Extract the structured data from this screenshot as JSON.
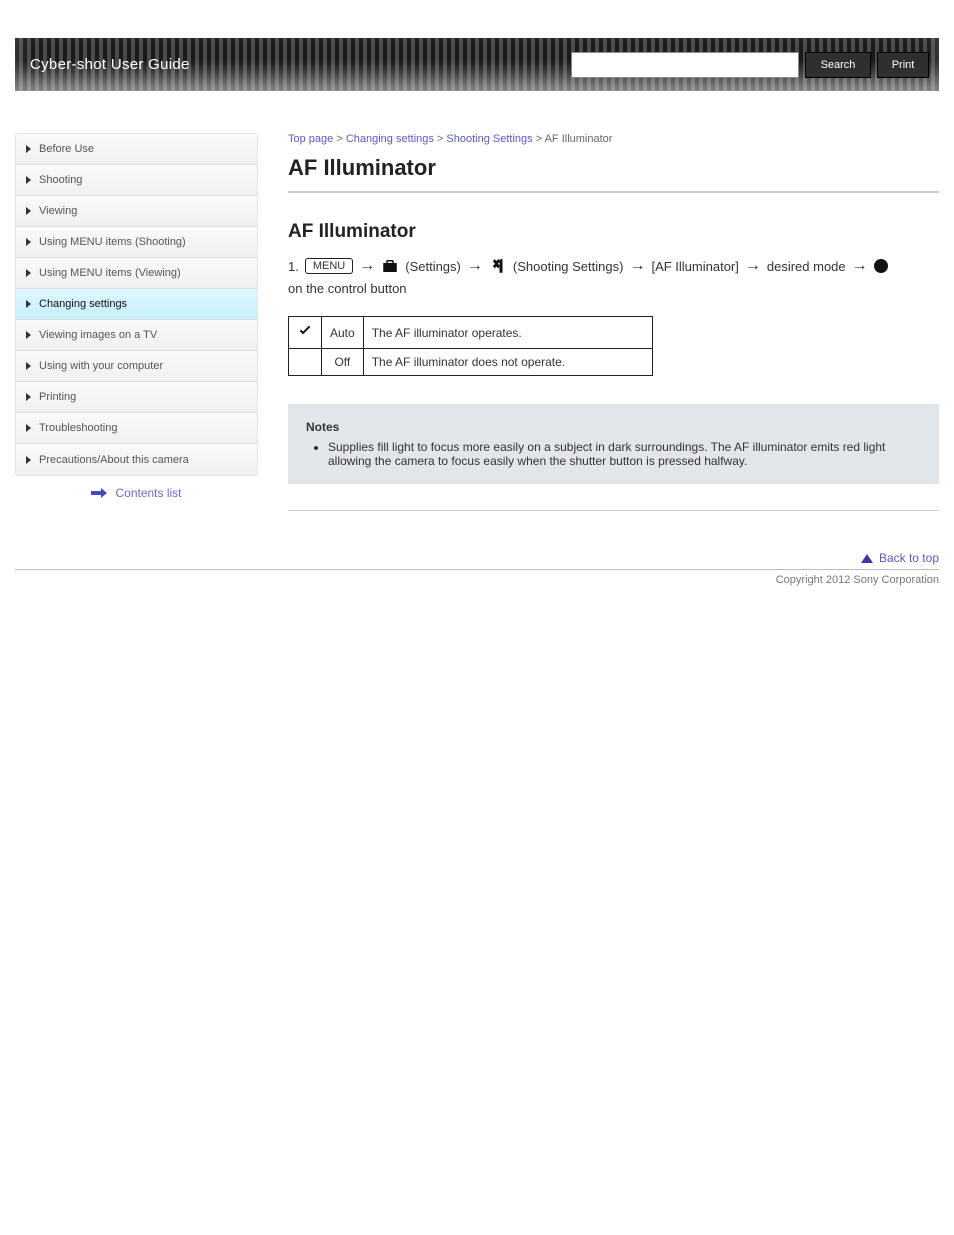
{
  "header": {
    "title": "Cyber-shot User Guide",
    "search_placeholder": "",
    "search_btn": "Search",
    "print_btn": "Print"
  },
  "sidebar": {
    "items": [
      {
        "label": "Before Use"
      },
      {
        "label": "Shooting"
      },
      {
        "label": "Viewing"
      },
      {
        "label": "Using MENU items (Shooting)"
      },
      {
        "label": "Using MENU items (Viewing)"
      },
      {
        "label": "Changing settings"
      },
      {
        "label": "Viewing images on a TV"
      },
      {
        "label": "Using with your computer"
      },
      {
        "label": "Printing"
      },
      {
        "label": "Troubleshooting"
      },
      {
        "label": "Precautions/About this camera"
      }
    ],
    "contents_link": "Contents list"
  },
  "breadcrumb": {
    "top": "Top page",
    "section": "Changing settings",
    "sub": "Shooting Settings",
    "current": "AF Illuminator"
  },
  "article": {
    "title": "AF Illuminator",
    "section": "AF Illuminator",
    "menu_path": {
      "key": "MENU",
      "toolbox": "",
      "step1_num": "1",
      "step2_label": "[AF Illuminator]",
      "step3_label": "desired mode",
      "step4_icon": "rec",
      "step5_label": "on the control button"
    },
    "table": [
      {
        "icon": "check",
        "label": "Auto",
        "desc": "The AF illuminator operates."
      },
      {
        "icon": "",
        "label": "Off",
        "desc": "The AF illuminator does not operate."
      }
    ],
    "note_title": "Notes",
    "note_items": [
      "Supplies fill light to focus more easily on a subject in dark surroundings. The AF illuminator emits red light allowing the camera to focus easily when the shutter button is pressed halfway."
    ]
  },
  "footer": {
    "top": "Back to top",
    "copyright": "Copyright 2012 Sony Corporation"
  }
}
